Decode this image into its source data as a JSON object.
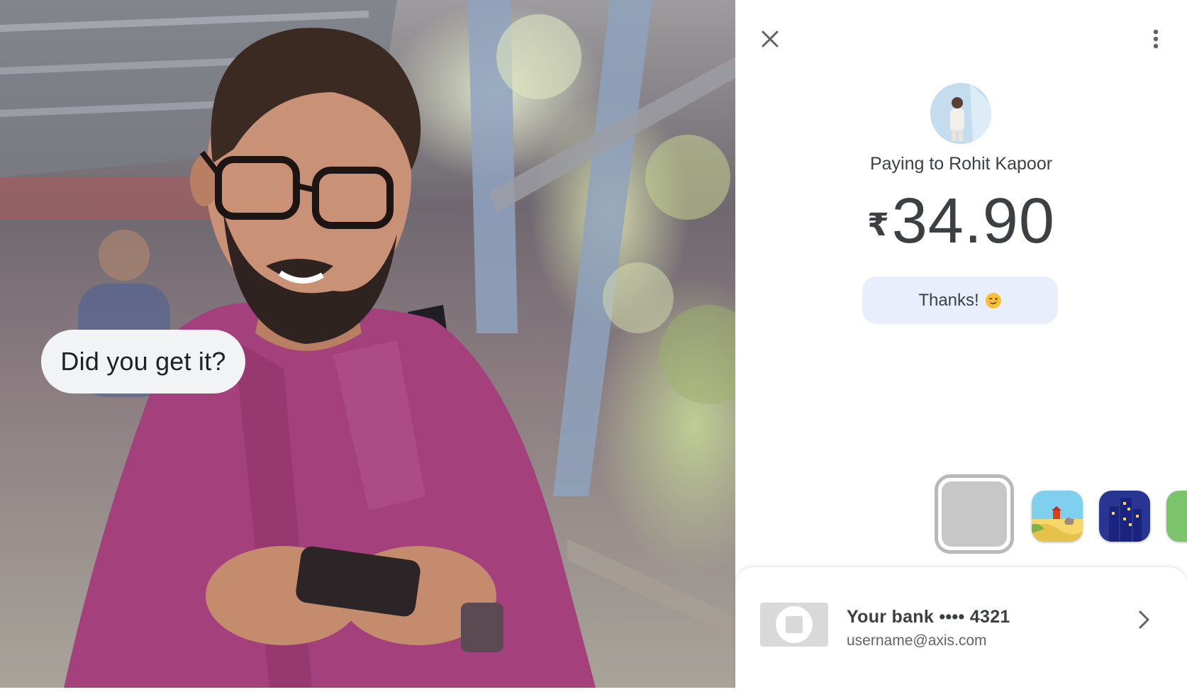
{
  "photo": {
    "speech_bubble": "Did you get it?"
  },
  "payment": {
    "close_icon": "close-icon",
    "more_icon": "more-vert-icon",
    "payee_label": "Paying to Rohit Kapoor",
    "currency_symbol": "₹",
    "amount": "34.90",
    "note": "Thanks!",
    "note_emoji": "winking-face-emoji",
    "themes": [
      "plain",
      "desert",
      "city",
      "other"
    ],
    "selected_theme": "plain",
    "bank": {
      "title": "Your bank •••• 4321",
      "upi_id": "username@axis.com"
    }
  },
  "colors": {
    "note_bg": "#e8eefb",
    "text_primary": "#3c4043",
    "text_secondary": "#5f6368",
    "bubble_bg": "#f1f3f4"
  }
}
